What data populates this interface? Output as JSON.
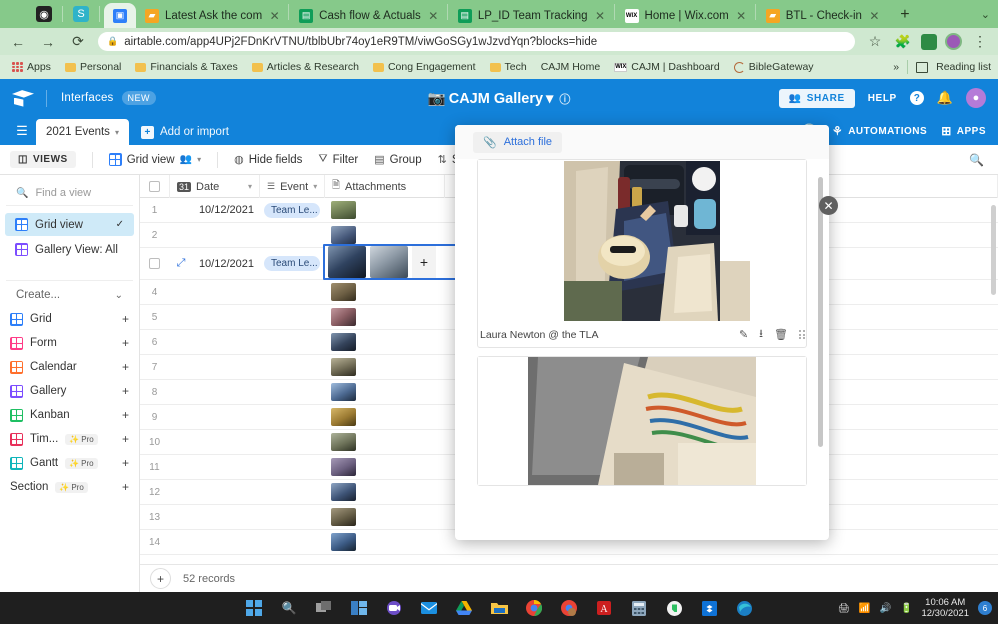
{
  "browser": {
    "tabs": [
      {
        "title": "Latest Ask the com",
        "favicon": "airtable-icon",
        "active": false
      },
      {
        "title": "Cash flow & Actuals",
        "favicon": "sheets-icon",
        "active": false
      },
      {
        "title": "LP_ID Team Tracking",
        "favicon": "sheets-icon",
        "active": false
      },
      {
        "title": "Home | Wix.com",
        "favicon": "wix-icon",
        "active": false
      },
      {
        "title": "BTL - Check-in",
        "favicon": "airtable-icon",
        "active": false
      }
    ],
    "new_tab_label": "+",
    "url": "airtable.com/app4UPj2FDnKrVTNU/tblbUbr74oy1eR9TM/viwGoSGy1wJzvdYqn?blocks=hide",
    "nav": {
      "back": "←",
      "forward": "→",
      "reload": "⟳",
      "star": "☆"
    },
    "bookmarks": [
      {
        "label": "Apps",
        "icon": "apps-grid-icon"
      },
      {
        "label": "Personal",
        "icon": "folder-icon"
      },
      {
        "label": "Financials & Taxes",
        "icon": "folder-icon"
      },
      {
        "label": "Articles & Research",
        "icon": "folder-icon"
      },
      {
        "label": "Cong Engagement",
        "icon": "folder-icon"
      },
      {
        "label": "Tech",
        "icon": "folder-icon"
      },
      {
        "label": "CAJM Home",
        "icon": "none"
      },
      {
        "label": "CAJM | Dashboard",
        "icon": "wix-icon"
      },
      {
        "label": "BibleGateway",
        "icon": "biblegateway-icon"
      }
    ],
    "overflow_label": "»",
    "reading_list_label": "Reading list"
  },
  "airtable": {
    "header": {
      "interfaces_label": "Interfaces",
      "new_badge": "NEW",
      "title": "CAJM Gallery",
      "title_icon": "camera-icon",
      "title_caret": "▾",
      "info_icon": "info-icon",
      "share_label": "SHARE",
      "help_label": "HELP",
      "question_icon": "?",
      "bell_icon": "bell-icon",
      "avatar_icon": "user-avatar"
    },
    "tabbar": {
      "menu_icon": "hamburger-icon",
      "table_name": "2021 Events",
      "table_caret": "▾",
      "add_import_label": "Add or import",
      "history_label": "",
      "automations_label": "AUTOMATIONS",
      "apps_label": "APPS"
    },
    "toolbar": {
      "views_label": "VIEWS",
      "grid_view_label": "Grid view",
      "hide_fields_label": "Hide fields",
      "filter_label": "Filter",
      "group_label": "Group",
      "sort_label": "Sort",
      "search_icon": "search-icon"
    },
    "sidebar": {
      "find_placeholder": "Find a view",
      "views": [
        {
          "label": "Grid view",
          "icon": "grid-icon",
          "color": "#2d7ff9",
          "selected": true,
          "check": "✓"
        },
        {
          "label": "Gallery View: All",
          "icon": "gallery-icon",
          "color": "#7c4dff",
          "selected": false,
          "check": ""
        }
      ],
      "create_label": "Create...",
      "create_caret": "⌄",
      "create_items": [
        {
          "label": "Grid",
          "icon": "grid-icon",
          "color": "#2d7ff9",
          "pro": false,
          "plus": "+"
        },
        {
          "label": "Form",
          "icon": "form-icon",
          "color": "#ff3b87",
          "pro": false,
          "plus": "+"
        },
        {
          "label": "Calendar",
          "icon": "calendar-icon",
          "color": "#ff6f2c",
          "pro": false,
          "plus": "+"
        },
        {
          "label": "Gallery",
          "icon": "gallery-icon",
          "color": "#7c4dff",
          "pro": false,
          "plus": "+"
        },
        {
          "label": "Kanban",
          "icon": "kanban-icon",
          "color": "#1fbf63",
          "pro": false,
          "plus": "+"
        },
        {
          "label": "Tim...",
          "icon": "timeline-icon",
          "color": "#e8305a",
          "pro": true,
          "plus": "+"
        },
        {
          "label": "Gantt",
          "icon": "gantt-icon",
          "color": "#0fb5ba",
          "pro": true,
          "plus": "+"
        },
        {
          "label": "Section",
          "icon": "section-icon",
          "color": "#888888",
          "pro": true,
          "plus": "+"
        }
      ],
      "pro_label": "Pro"
    },
    "grid": {
      "columns": [
        {
          "label": "Date",
          "icon": "calendar-31-icon"
        },
        {
          "label": "Event",
          "icon": "select-icon"
        },
        {
          "label": "Attachments",
          "icon": "file-icon"
        }
      ],
      "rows": [
        {
          "num": "1",
          "date": "10/12/2021",
          "event": "Team Le...",
          "has_thumb": true,
          "thumb": "#8a9a6b"
        },
        {
          "num": "2",
          "date": "",
          "event": "",
          "has_thumb": true,
          "thumb": "#5a6f8c"
        },
        {
          "num": "3",
          "date": "10/12/2021",
          "event": "Team Le...",
          "has_thumb": true,
          "thumb": "#3c4a63",
          "selected": true
        },
        {
          "num": "4",
          "date": "",
          "event": "",
          "has_thumb": true,
          "thumb": "#7d7360"
        },
        {
          "num": "5",
          "date": "",
          "event": "",
          "has_thumb": true,
          "thumb": "#9c6b72"
        },
        {
          "num": "6",
          "date": "",
          "event": "",
          "has_thumb": true,
          "thumb": "#4e5d73"
        },
        {
          "num": "7",
          "date": "",
          "event": "",
          "has_thumb": true,
          "thumb": "#7b7666"
        },
        {
          "num": "8",
          "date": "",
          "event": "",
          "has_thumb": true,
          "thumb": "#6d84a4"
        },
        {
          "num": "9",
          "date": "",
          "event": "",
          "has_thumb": true,
          "thumb": "#a08447"
        },
        {
          "num": "10",
          "date": "",
          "event": "",
          "has_thumb": true,
          "thumb": "#8d8f7e"
        },
        {
          "num": "11",
          "date": "",
          "event": "",
          "has_thumb": true,
          "thumb": "#7b7487"
        },
        {
          "num": "12",
          "date": "",
          "event": "",
          "has_thumb": true,
          "thumb": "#586784"
        },
        {
          "num": "13",
          "date": "",
          "event": "",
          "has_thumb": true,
          "thumb": "#6a6354"
        },
        {
          "num": "14",
          "date": "",
          "event": "",
          "has_thumb": true,
          "thumb": "#4b6a90"
        }
      ],
      "selected_cell": {
        "plus": "+",
        "thumbs": 2
      },
      "record_count": "52 records",
      "add_row_label": "+"
    },
    "attachment_panel": {
      "attach_file_label": "Attach file",
      "attach_icon": "paperclip-icon",
      "close_icon": "close-icon",
      "items": [
        {
          "caption": "Laura Newton @ the TLA",
          "actions": [
            "edit-icon",
            "download-icon",
            "trash-icon",
            "grip-icon"
          ]
        },
        {
          "caption": "",
          "actions": []
        }
      ]
    }
  },
  "taskbar": {
    "items": [
      {
        "name": "start-button"
      },
      {
        "name": "search-icon"
      },
      {
        "name": "task-view-icon"
      },
      {
        "name": "widgets-icon"
      },
      {
        "name": "teams-icon"
      },
      {
        "name": "mail-icon"
      },
      {
        "name": "google-drive-icon"
      },
      {
        "name": "file-explorer-icon"
      },
      {
        "name": "chrome-icon"
      },
      {
        "name": "chrome-profile-icon"
      },
      {
        "name": "adobe-acrobat-icon"
      },
      {
        "name": "calculator-icon"
      },
      {
        "name": "evernote-icon"
      },
      {
        "name": "dropbox-icon"
      },
      {
        "name": "edge-icon"
      }
    ],
    "tray": {
      "icons": [
        "printer-icon",
        "wifi-icon",
        "volume-icon",
        "battery-icon"
      ],
      "time": "10:06 AM",
      "date": "12/30/2021",
      "badge": "6"
    }
  }
}
